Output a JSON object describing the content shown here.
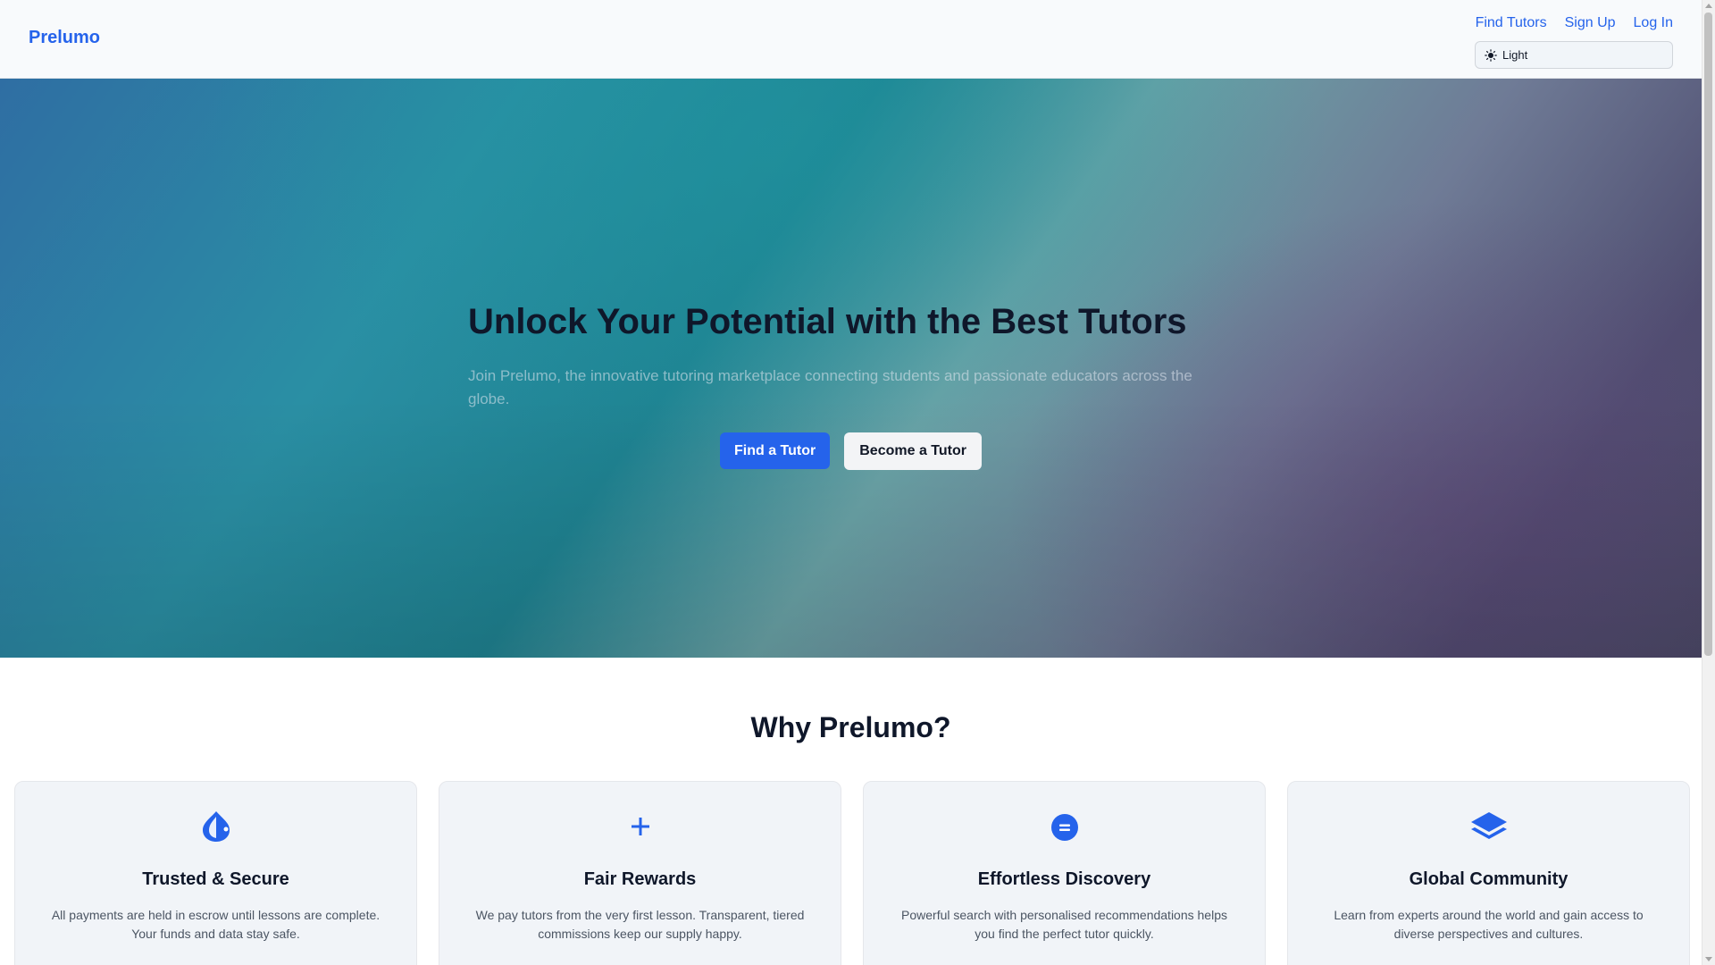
{
  "header": {
    "brand": "Prelumo",
    "nav": [
      {
        "label": "Find Tutors"
      },
      {
        "label": "Sign Up"
      },
      {
        "label": "Log In"
      }
    ],
    "theme": {
      "selected": "Light",
      "icon": "sun-icon"
    }
  },
  "hero": {
    "title": "Unlock Your Potential with the Best Tutors",
    "subtitle": "Join Prelumo, the innovative tutoring marketplace connecting students and passionate educators across the globe.",
    "primary_button": "Find a Tutor",
    "secondary_button": "Become a Tutor"
  },
  "why": {
    "title": "Why Prelumo?",
    "cards": [
      {
        "icon": "shield-drop-icon",
        "title": "Trusted & Secure",
        "text": "All payments are held in escrow until lessons are complete. Your funds and data stay safe."
      },
      {
        "icon": "plus-icon",
        "title": "Fair Rewards",
        "text": "We pay tutors from the very first lesson. Transparent, tiered commissions keep our supply happy."
      },
      {
        "icon": "search-circle-icon",
        "title": "Effortless Discovery",
        "text": "Powerful search with personalised recommendations helps you find the perfect tutor quickly."
      },
      {
        "icon": "layers-icon",
        "title": "Global Community",
        "text": "Learn from experts around the world and gain access to diverse perspectives and cultures."
      }
    ]
  },
  "colors": {
    "accent": "#2563eb",
    "text": "#0f172a",
    "muted": "#4b5563"
  }
}
